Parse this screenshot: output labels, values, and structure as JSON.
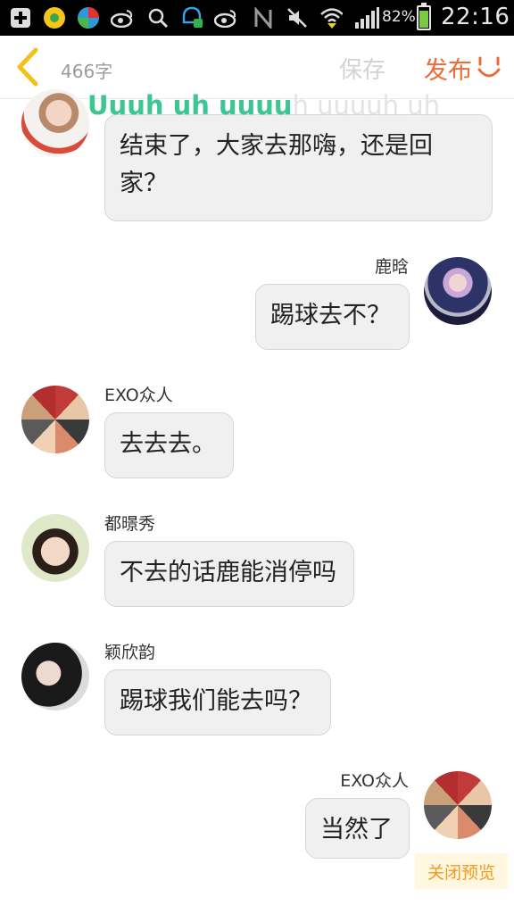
{
  "status_bar": {
    "battery_percent": "82%",
    "time": "22:16",
    "icons": [
      "add-icon",
      "qq-music-icon",
      "colorful-app-icon",
      "weibo-icon",
      "search-icon",
      "message-icon",
      "weibo-icon",
      "nfc-icon",
      "mute-icon",
      "wifi-icon",
      "signal-icon",
      "battery-icon"
    ]
  },
  "toolbar": {
    "char_count": "466字",
    "save_label": "保存",
    "publish_label": "发布"
  },
  "lyric": {
    "highlighted": "Uuuh uh uuuu",
    "rest": "h uuuuh uh"
  },
  "messages": [
    {
      "side": "left",
      "name": "",
      "text": "结束了，大家去那嗨，还是回家？",
      "avatar": "girl-photo"
    },
    {
      "side": "right",
      "name": "鹿晗",
      "text": "踢球去不？",
      "avatar": "luhan-photo"
    },
    {
      "side": "left",
      "name": "EXO众人",
      "text": "去去去。",
      "avatar": "group-photo"
    },
    {
      "side": "left",
      "name": "都暻秀",
      "text": "不去的话鹿能消停吗",
      "avatar": "boy-photo"
    },
    {
      "side": "left",
      "name": "颖欣韵",
      "text": "踢球我们能去吗？",
      "avatar": "girl2-photo"
    },
    {
      "side": "right",
      "name": "EXO众人",
      "text": "当然了",
      "avatar": "group-photo"
    }
  ],
  "footer": {
    "close_preview_label": "关闭预览"
  },
  "colors": {
    "accent": "#f06a35",
    "back_arrow": "#f2c21b",
    "lyric_highlight": "#3dc694",
    "bubble_bg": "#f0f0f0"
  }
}
